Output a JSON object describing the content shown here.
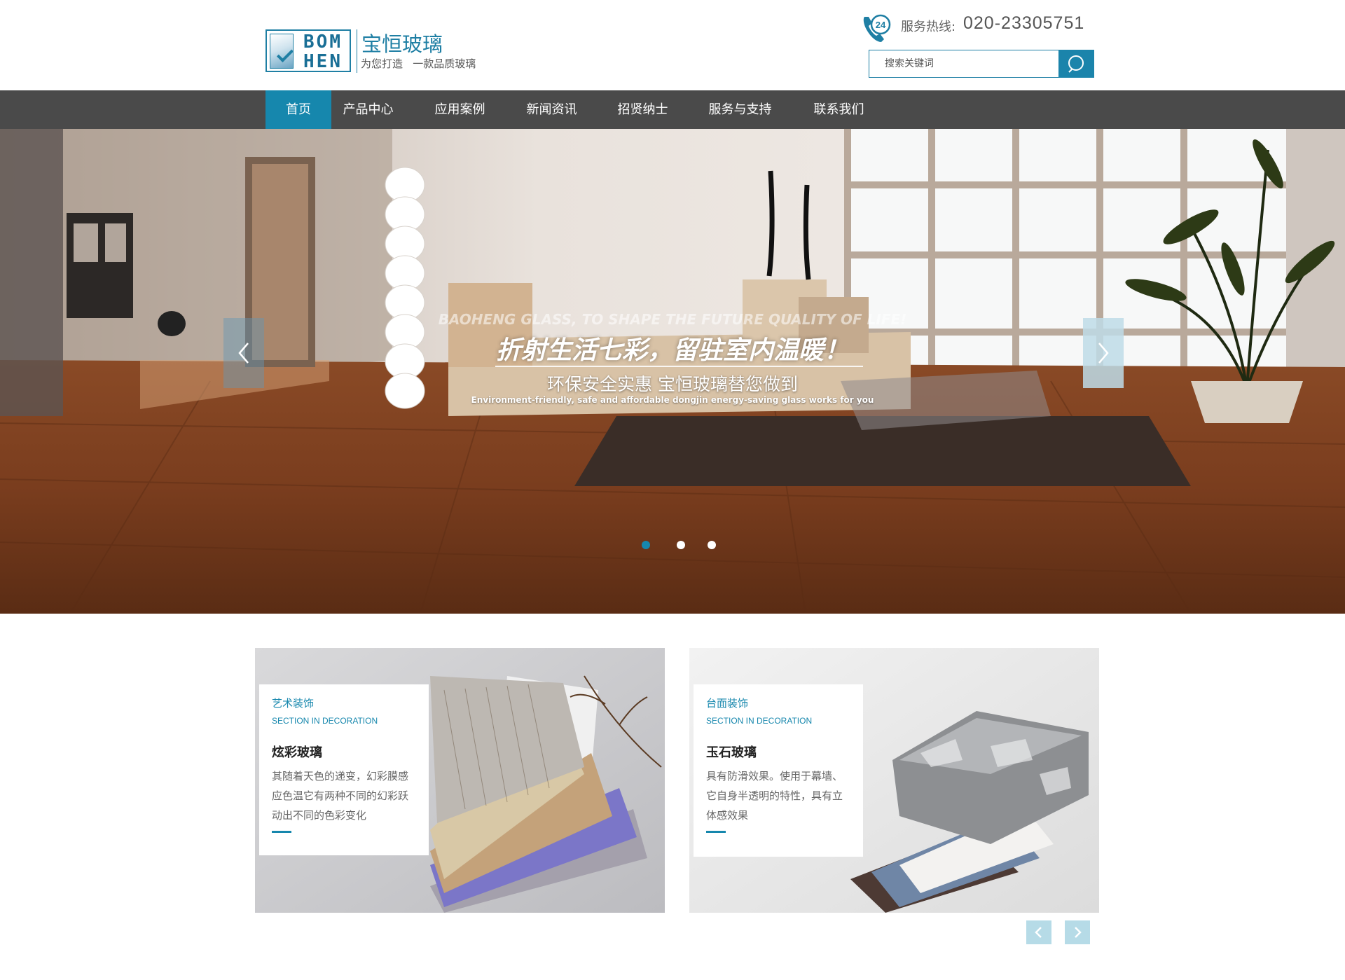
{
  "header": {
    "logo_line1": "BOM",
    "logo_line2": "HEN",
    "brand_name": "宝恒玻璃",
    "slogan": "为您打造   一款品质玻璃",
    "hotline_label": "服务热线:",
    "hotline_number": "020-23305751",
    "phone_badge": "24",
    "search_placeholder": "搜索关键词"
  },
  "nav": {
    "items": [
      {
        "label": "首页",
        "active": true
      },
      {
        "label": "产品中心"
      },
      {
        "label": "应用案例"
      },
      {
        "label": "新闻资讯"
      },
      {
        "label": "招贤纳士"
      },
      {
        "label": "服务与支持"
      },
      {
        "label": "联系我们"
      }
    ]
  },
  "banner": {
    "en_top": "BAOHENG GLASS, TO SHAPE THE FUTURE QUALITY OF LIFE!",
    "title": "折射生活七彩，留驻室内温暖！",
    "subtitle": "环保安全实惠  宝恒玻璃替您做到",
    "en_bottom": "Environment-friendly, safe and affordable dongjin energy-saving glass works for you",
    "slides": 3,
    "active_slide": 1,
    "prev_icon": "chevron-left-icon",
    "next_icon": "chevron-right-icon"
  },
  "cards": [
    {
      "tag": "艺术装饰",
      "en": "SECTION IN DECORATION",
      "title": "炫彩玻璃",
      "desc": "其随着天色的递变，幻彩膜感应色温它有两种不同的幻彩跃动出不同的色彩变化"
    },
    {
      "tag": "台面装饰",
      "en": "SECTION IN DECORATION",
      "title": "玉石玻璃",
      "desc": "具有防滑效果。使用于幕墙、它自身半透明的特性，具有立体感效果"
    }
  ],
  "colors": {
    "accent": "#1687ad",
    "nav_bg": "#4a4a4a"
  }
}
